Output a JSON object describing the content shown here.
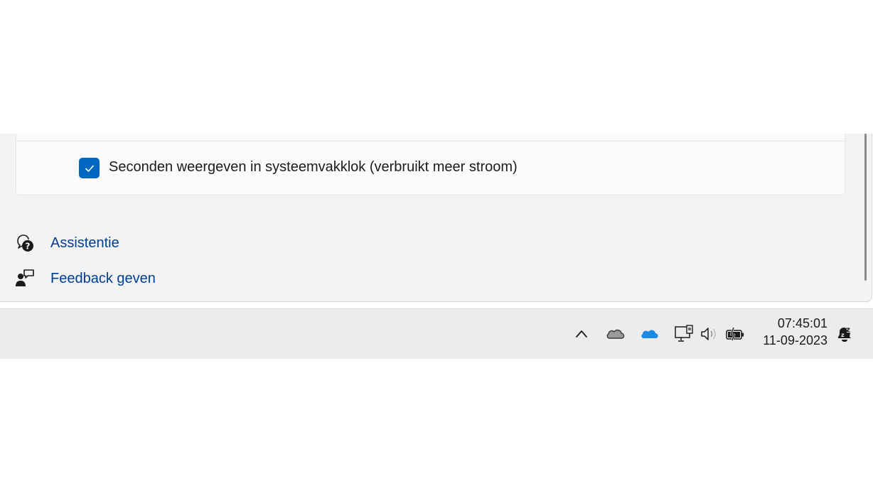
{
  "settings": {
    "seconds_checkbox": {
      "label": "Seconden weergeven in systeemvakklok (verbruikt meer stroom)",
      "checked": true,
      "accent": "#0067c0"
    },
    "links": [
      {
        "label": "Assistentie",
        "icon": "help-chat-icon"
      },
      {
        "label": "Feedback geven",
        "icon": "feedback-person-icon"
      }
    ],
    "link_color": "#003e92"
  },
  "taskbar": {
    "tray_icons": [
      "chevron-up-icon",
      "onedrive-gray-icon",
      "onedrive-blue-icon",
      "network-pc-icon",
      "volume-icon",
      "battery-charging-icon"
    ],
    "clock": {
      "time": "07:45:01",
      "date": "11-09-2023"
    },
    "notification_icon": "notification-bell-snooze-icon"
  }
}
